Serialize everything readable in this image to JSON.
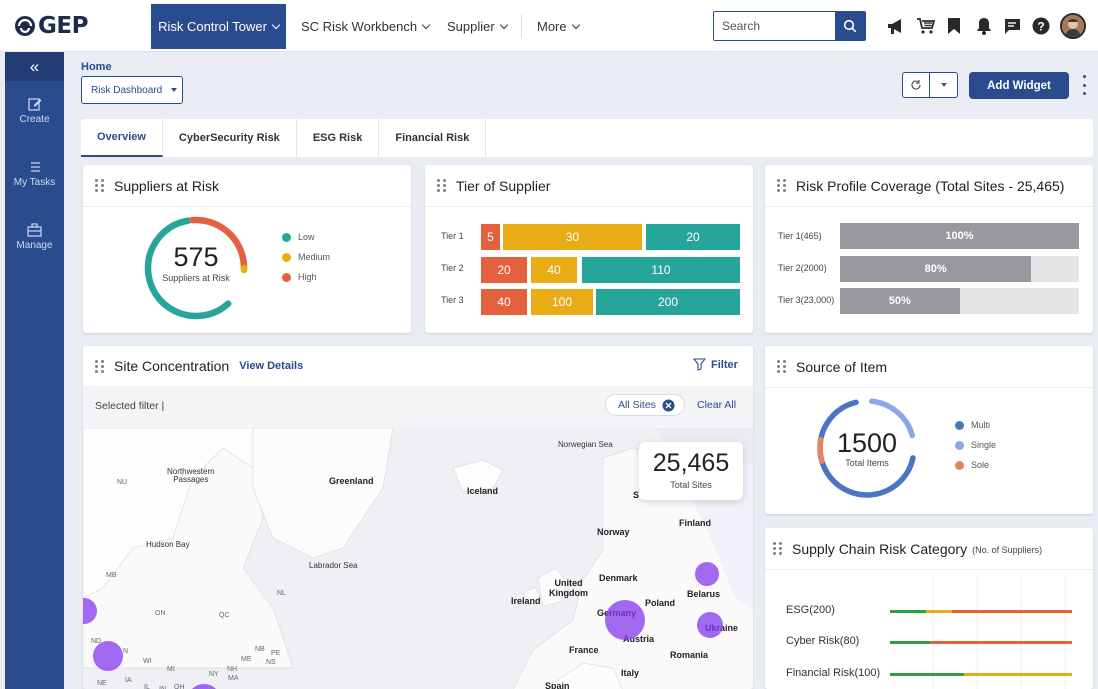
{
  "brand": {
    "logo": "GEP"
  },
  "nav": {
    "items": [
      {
        "label": "Risk Control Tower",
        "active": true
      },
      {
        "label": "SC Risk Workbench",
        "active": false
      },
      {
        "label": "Supplier",
        "active": false
      },
      {
        "label": "More",
        "active": false
      }
    ],
    "search_placeholder": "Search",
    "icons": [
      "megaphone-icon",
      "cart-icon",
      "bookmark-icon",
      "bell-icon",
      "chat-icon",
      "help-icon"
    ]
  },
  "sidebar": {
    "collapse": "«",
    "items": [
      {
        "label": "Create",
        "icon": "edit-icon"
      },
      {
        "label": "My Tasks",
        "icon": "list-icon"
      },
      {
        "label": "Manage",
        "icon": "briefcase-icon"
      }
    ]
  },
  "header": {
    "breadcrumb": "Home",
    "dashboard_select": "Risk Dashboard",
    "add_widget": "Add Widget"
  },
  "tabs": [
    "Overview",
    "CyberSecurity Risk",
    "ESG Risk",
    "Financial Risk"
  ],
  "colors": {
    "brand": "#2b4b8f",
    "low": "#26a69a",
    "medium": "#e8ac16",
    "high": "#e4613d",
    "multi": "#4a74c4",
    "single": "#8aa7e8",
    "sole": "#e8845d",
    "coverage": "#97999e"
  },
  "suppliers_at_risk": {
    "title": "Suppliers at Risk",
    "total": "575",
    "caption": "Suppliers at Risk",
    "legend": [
      {
        "label": "Low",
        "color": "#26a69a"
      },
      {
        "label": "Medium",
        "color": "#e8ac16"
      },
      {
        "label": "High",
        "color": "#e4613d"
      }
    ]
  },
  "tier_of_supplier": {
    "title": "Tier of Supplier",
    "rows": [
      {
        "label": "Tier 1",
        "segments": [
          {
            "value": "5",
            "color": "#e4613d"
          },
          {
            "value": "30",
            "color": "#e8ac16"
          },
          {
            "value": "20",
            "color": "#26a69a"
          }
        ]
      },
      {
        "label": "Tier 2",
        "segments": [
          {
            "value": "20",
            "color": "#e4613d"
          },
          {
            "value": "40",
            "color": "#e8ac16"
          },
          {
            "value": "110",
            "color": "#26a69a"
          }
        ]
      },
      {
        "label": "Tier 3",
        "segments": [
          {
            "value": "40",
            "color": "#e4613d"
          },
          {
            "value": "100",
            "color": "#e8ac16"
          },
          {
            "value": "200",
            "color": "#26a69a"
          }
        ]
      }
    ]
  },
  "risk_profile": {
    "title": "Risk Profile Coverage (Total Sites - 25,465)",
    "rows": [
      {
        "label": "Tier 1(465)",
        "percent": "100%",
        "fraction": 1.0
      },
      {
        "label": "Tier 2(2000)",
        "percent": "80%",
        "fraction": 0.8
      },
      {
        "label": "Tier 3(23,000)",
        "percent": "50%",
        "fraction": 0.5
      }
    ]
  },
  "site_concentration": {
    "title": "Site Concentration",
    "view_details": "View Details",
    "filter": "Filter",
    "selected_filter": "Selected filter |",
    "chip": "All Sites",
    "clear_all": "Clear All",
    "total": "25,465",
    "total_caption": "Total Sites",
    "map_labels": {
      "norwegian_sea": "Norwegian Sea",
      "nw_passages": "Northwestern\nPassages",
      "nu": "NU",
      "greenland": "Greenland",
      "iceland": "Iceland",
      "s": "S",
      "finland": "Finland",
      "norway": "Norway",
      "hudson_bay": "Hudson Bay",
      "labrador_sea": "Labrador Sea",
      "mb": "MB",
      "nl": "NL",
      "on": "ON",
      "qc": "QC",
      "denmark": "Denmark",
      "united_kingdom": "United\nKingdom",
      "ireland": "Ireland",
      "belarus": "Belarus",
      "germany": "Germany",
      "poland": "Poland",
      "ukraine": "Ukraine",
      "austria": "Austria",
      "france": "France",
      "romania": "Romania",
      "italy": "Italy",
      "spain": "Spain",
      "nb": "NB",
      "pe": "PE",
      "me": "ME",
      "ns": "NS",
      "nh": "NH",
      "ma": "MA",
      "ny": "NY",
      "wi": "WI",
      "mi": "MI",
      "ne": "NE",
      "ia": "IA",
      "il": "IL",
      "in": "IN",
      "oh": "OH",
      "nd": "ND",
      "n": "N"
    }
  },
  "source_of_item": {
    "title": "Source of Item",
    "total": "1500",
    "caption": "Total Items",
    "legend": [
      {
        "label": "Multi",
        "color": "#4a74c4"
      },
      {
        "label": "Single",
        "color": "#8aa7e8"
      },
      {
        "label": "Sole",
        "color": "#e8845d"
      }
    ]
  },
  "supply_chain_risk": {
    "title": "Supply Chain Risk Category",
    "subtitle": "(No. of Suppliers)",
    "rows": [
      {
        "label": "ESG(200)"
      },
      {
        "label": "Cyber Risk(80)"
      },
      {
        "label": "Financial Risk(100)"
      }
    ]
  }
}
